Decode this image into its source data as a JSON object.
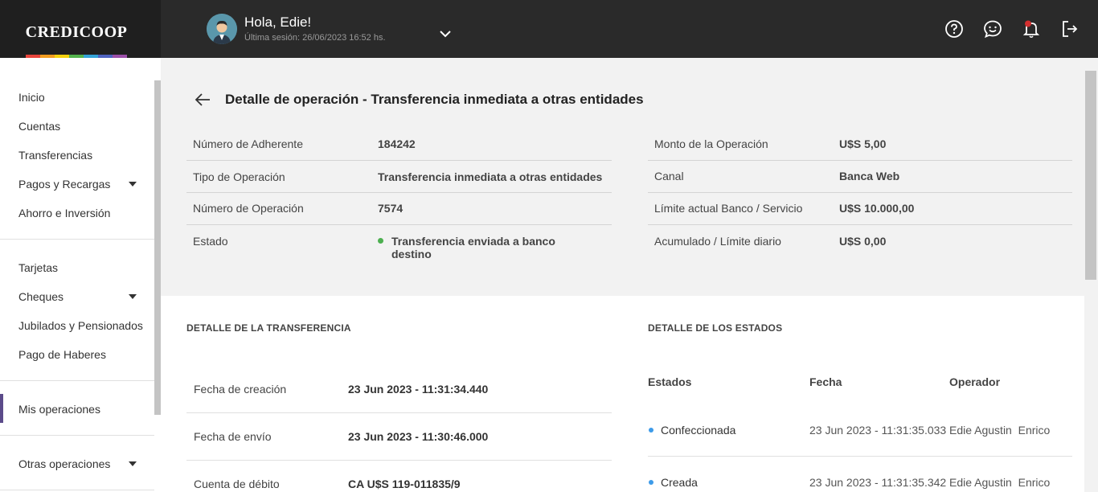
{
  "brand": {
    "name": "CREDICOOP",
    "stripe_colors": [
      "#e8453c",
      "#f29c1f",
      "#f5d10e",
      "#53b24c",
      "#33a3d8",
      "#4f63c0",
      "#9b4fa8"
    ]
  },
  "header": {
    "greeting": "Hola, Edie!",
    "last_session": "Última sesión: 26/06/2023 16:52 hs.",
    "icons": [
      "help-icon",
      "chat-icon",
      "notification-bell-icon",
      "logout-icon"
    ]
  },
  "sidebar": {
    "items": [
      {
        "label": "Inicio"
      },
      {
        "label": "Cuentas"
      },
      {
        "label": "Transferencias"
      },
      {
        "label": "Pagos y Recargas"
      },
      {
        "label": "Ahorro e Inversión"
      },
      {
        "label": "Tarjetas"
      },
      {
        "label": "Cheques"
      },
      {
        "label": "Jubilados y Pensionados"
      },
      {
        "label": "Pago de Haberes"
      },
      {
        "label": "Mis operaciones"
      },
      {
        "label": "Otras operaciones"
      }
    ],
    "active": "Mis operaciones"
  },
  "page": {
    "title": "Detalle de operación - Transferencia inmediata a otras entidades"
  },
  "summary": {
    "left": [
      {
        "label": "Número de Adherente",
        "value": "184242"
      },
      {
        "label": "Tipo de Operación",
        "value": "Transferencia inmediata a otras entidades"
      },
      {
        "label": "Número de Operación",
        "value": "7574"
      },
      {
        "label": "Estado",
        "value": "Transferencia enviada a banco destino"
      }
    ],
    "right": [
      {
        "label": "Monto de la Operación",
        "value": "U$S 5,00"
      },
      {
        "label": "Canal",
        "value": "Banca Web"
      },
      {
        "label": "Límite actual Banco / Servicio",
        "value": "U$S 10.000,00"
      },
      {
        "label": "Acumulado / Límite diario",
        "value": "U$S 0,00"
      }
    ]
  },
  "transfer_detail": {
    "title": "DETALLE DE LA TRANSFERENCIA",
    "rows": [
      {
        "label": "Fecha de creación",
        "value": "23 Jun 2023 - 11:31:34.440"
      },
      {
        "label": "Fecha de envío",
        "value": "23 Jun 2023 - 11:30:46.000"
      },
      {
        "label": "Cuenta de débito",
        "value": "CA U$S 119-011835/9"
      }
    ]
  },
  "states_detail": {
    "title": "DETALLE DE LOS ESTADOS",
    "columns": [
      "Estados",
      "Fecha",
      "Operador"
    ],
    "rows": [
      {
        "estado": "Confeccionada",
        "fecha": "23 Jun 2023 - 11:31:35.033",
        "operador": "Edie Agustin  Enrico"
      },
      {
        "estado": "Creada",
        "fecha": "23 Jun 2023 - 11:31:35.342",
        "operador": "Edie Agustin  Enrico"
      }
    ]
  }
}
